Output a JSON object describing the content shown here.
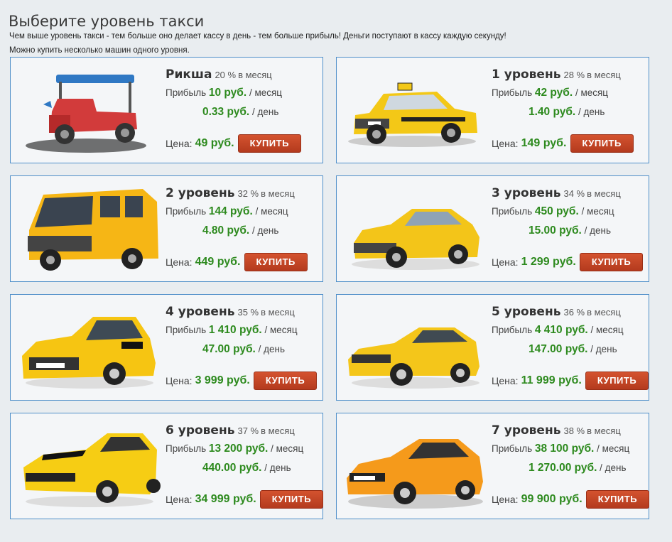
{
  "page": {
    "title": "Выберите уровень такси",
    "intro_line1": "Чем выше уровень такси - тем больше оно делает кассу в день - тем больше прибыль! Деньги поступают в кассу каждую секунду!",
    "intro_line2": "Можно купить несколько машин одного уровня."
  },
  "labels": {
    "per_month": "в месяц",
    "profit": "Прибыль",
    "month_suffix": "/ месяц",
    "day_suffix": "/ день",
    "price": "Цена:",
    "buy": "КУПИТЬ"
  },
  "colors": {
    "accent_green": "#2d8a1e",
    "button": "#c7472a",
    "card_border": "#4f8fc9"
  },
  "levels": [
    {
      "name": "Рикша",
      "percent": "20 %",
      "month": "10 руб.",
      "day": "0.33 руб.",
      "price": "49 руб.",
      "image": "rickshaw-image"
    },
    {
      "name": "1 уровень",
      "percent": "28 %",
      "month": "42 руб.",
      "day": "1.40 руб.",
      "price": "149 руб.",
      "image": "lada-taxi-image"
    },
    {
      "name": "2 уровень",
      "percent": "32 %",
      "month": "144 руб.",
      "day": "4.80 руб.",
      "price": "449 руб.",
      "image": "gazelle-van-image"
    },
    {
      "name": "3 уровень",
      "percent": "34 %",
      "month": "450 руб.",
      "day": "15.00 руб.",
      "price": "1 299 руб.",
      "image": "sedan-image"
    },
    {
      "name": "4 уровень",
      "percent": "35 %",
      "month": "1 410 руб.",
      "day": "47.00 руб.",
      "price": "3 999 руб.",
      "image": "hatchback-taxi-image"
    },
    {
      "name": "5 уровень",
      "percent": "36 %",
      "month": "4 410 руб.",
      "day": "147.00 руб.",
      "price": "11 999 руб.",
      "image": "coupe-image"
    },
    {
      "name": "6 уровень",
      "percent": "37 %",
      "month": "13 200 руб.",
      "day": "440.00 руб.",
      "price": "34 999 руб.",
      "image": "muscle-car-image"
    },
    {
      "name": "7 уровень",
      "percent": "38 %",
      "month": "38 100 руб.",
      "day": "1 270.00 руб.",
      "price": "99 900 руб.",
      "image": "sports-car-image"
    }
  ]
}
